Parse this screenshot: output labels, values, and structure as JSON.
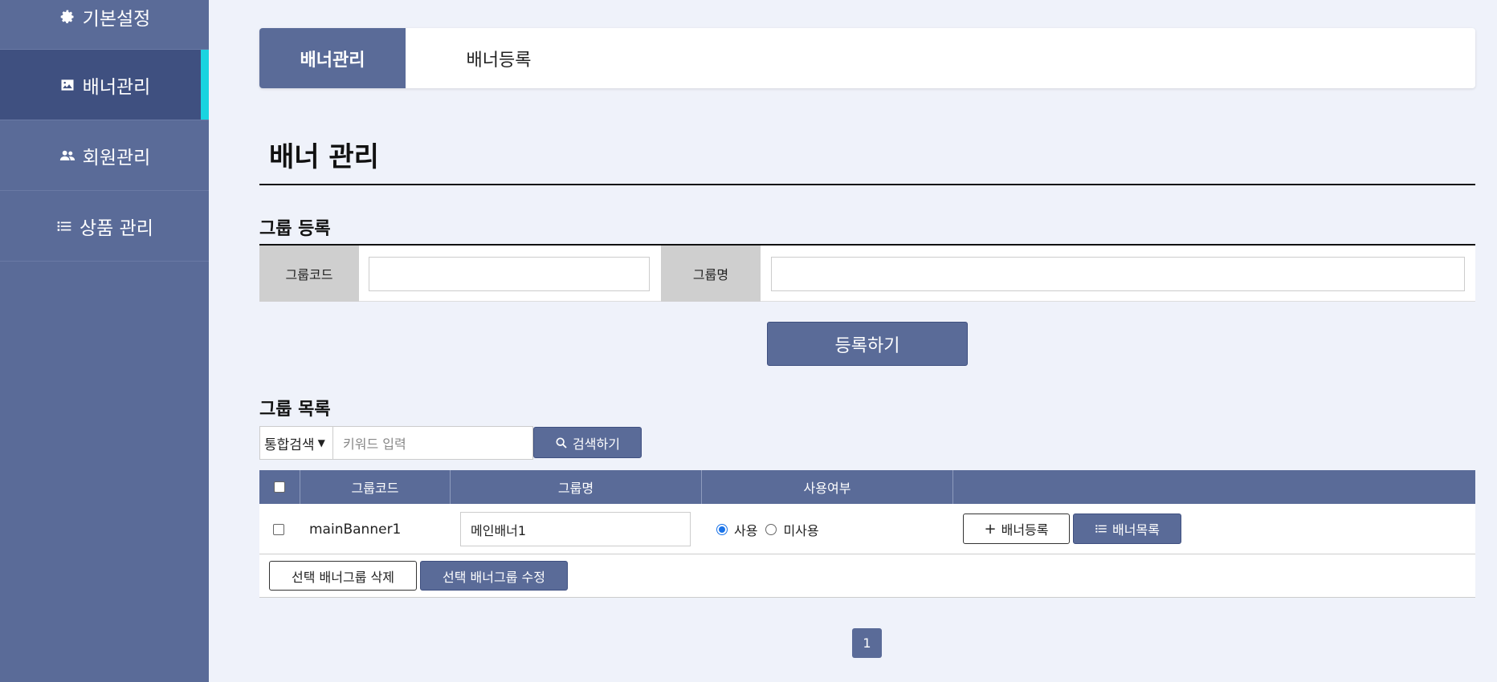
{
  "sidebar": {
    "items": [
      {
        "label": "기본설정",
        "icon": "gear-icon"
      },
      {
        "label": "배너관리",
        "icon": "image-icon",
        "active": true
      },
      {
        "label": "회원관리",
        "icon": "users-icon"
      },
      {
        "label": "상품 관리",
        "icon": "list-icon"
      }
    ],
    "active_indicator_color": "#1ad4e0"
  },
  "tabs": [
    {
      "label": "배너관리",
      "active": true
    },
    {
      "label": "배너등록",
      "active": false
    }
  ],
  "page_title": "배너 관리",
  "group_register": {
    "title": "그룹 등록",
    "code_label": "그룹코드",
    "code_value": "",
    "name_label": "그룹명",
    "name_value": "",
    "submit_label": "등록하기"
  },
  "group_list": {
    "title": "그룹 목록",
    "search_type": "통합검색",
    "search_placeholder": "키워드 입력",
    "search_button": "검색하기",
    "columns": [
      "그룹코드",
      "그룹명",
      "사용여부",
      ""
    ],
    "rows": [
      {
        "code": "mainBanner1",
        "name": "메인배너1",
        "use_options": [
          "사용",
          "미사용"
        ],
        "use_selected": "사용",
        "add_banner_label": "배너등록",
        "banner_list_label": "배너목록"
      }
    ],
    "delete_selected_label": "선택 배너그룹 삭제",
    "edit_selected_label": "선택 배너그룹 수정"
  },
  "pagination": {
    "current": "1"
  },
  "colors": {
    "primary": "#5a6b98",
    "sidebar": "#5a6b98",
    "sidebar_active": "#3f5080",
    "background": "#eff2fa"
  }
}
